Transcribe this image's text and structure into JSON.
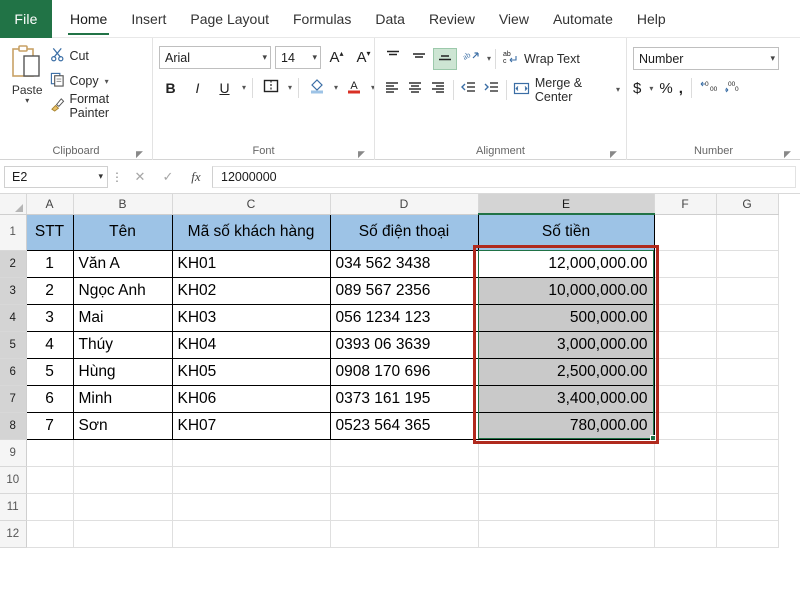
{
  "ribbon": {
    "file_tab": "File",
    "tabs": [
      {
        "label": "Home",
        "active": true
      },
      {
        "label": "Insert",
        "active": false
      },
      {
        "label": "Page Layout",
        "active": false
      },
      {
        "label": "Formulas",
        "active": false
      },
      {
        "label": "Data",
        "active": false
      },
      {
        "label": "Review",
        "active": false
      },
      {
        "label": "View",
        "active": false
      },
      {
        "label": "Automate",
        "active": false
      },
      {
        "label": "Help",
        "active": false
      }
    ],
    "groups": {
      "clipboard": {
        "label": "Clipboard",
        "paste": "Paste",
        "cut": "Cut",
        "copy": "Copy",
        "format_painter": "Format Painter"
      },
      "font": {
        "label": "Font",
        "font_name": "Arial",
        "font_size": "14",
        "bold": "B",
        "italic": "I",
        "underline": "U",
        "increase_size": "A",
        "decrease_size": "A"
      },
      "alignment": {
        "label": "Alignment",
        "wrap_text": "Wrap Text",
        "merge_center": "Merge & Center"
      },
      "number": {
        "label": "Number",
        "format": "Number",
        "currency": "$",
        "percent": "%",
        "comma": ",",
        "increase_decimal": ".00",
        "decrease_decimal": ".00"
      }
    }
  },
  "formula_bar": {
    "name_box": "E2",
    "formula_value": "12000000",
    "cancel": "✕",
    "enter": "✓",
    "insert_function": "fx"
  },
  "grid": {
    "columns": [
      "A",
      "B",
      "C",
      "D",
      "E",
      "F",
      "G"
    ],
    "selected_column": "E",
    "rows": [
      "1",
      "2",
      "3",
      "4",
      "5",
      "6",
      "7",
      "8",
      "9",
      "10",
      "11",
      "12"
    ],
    "selected_rows": [
      "2",
      "3",
      "4",
      "5",
      "6",
      "7",
      "8"
    ],
    "header_fill": "#9DC3E6",
    "selection_fill": "#C9C9C9",
    "selection_border": "#1F7246",
    "annotation_color": "#B02A1E",
    "table_headers": [
      "STT",
      "Tên",
      "Mã số khách hàng",
      "Số điện thoại",
      "Số tiền"
    ],
    "table_rows": [
      {
        "stt": "1",
        "ten": "Văn A",
        "ma": "KH01",
        "sdt": "034 562 3438",
        "tien": "12,000,000.00",
        "active": true
      },
      {
        "stt": "2",
        "ten": "Ngọc Anh",
        "ma": "KH02",
        "sdt": "089 567 2356",
        "tien": "10,000,000.00",
        "active": false
      },
      {
        "stt": "3",
        "ten": "Mai",
        "ma": "KH03",
        "sdt": "056 1234 123",
        "tien": "500,000.00",
        "active": false
      },
      {
        "stt": "4",
        "ten": "Thúy",
        "ma": "KH04",
        "sdt": "0393 06 3639",
        "tien": "3,000,000.00",
        "active": false
      },
      {
        "stt": "5",
        "ten": "Hùng",
        "ma": "KH05",
        "sdt": "0908 170 696",
        "tien": "2,500,000.00",
        "active": false
      },
      {
        "stt": "6",
        "ten": "Minh",
        "ma": "KH06",
        "sdt": "0373 161 195",
        "tien": "3,400,000.00",
        "active": false
      },
      {
        "stt": "7",
        "ten": "Sơn",
        "ma": "KH07",
        "sdt": "0523 564 365",
        "tien": "780,000.00",
        "active": false
      }
    ]
  }
}
